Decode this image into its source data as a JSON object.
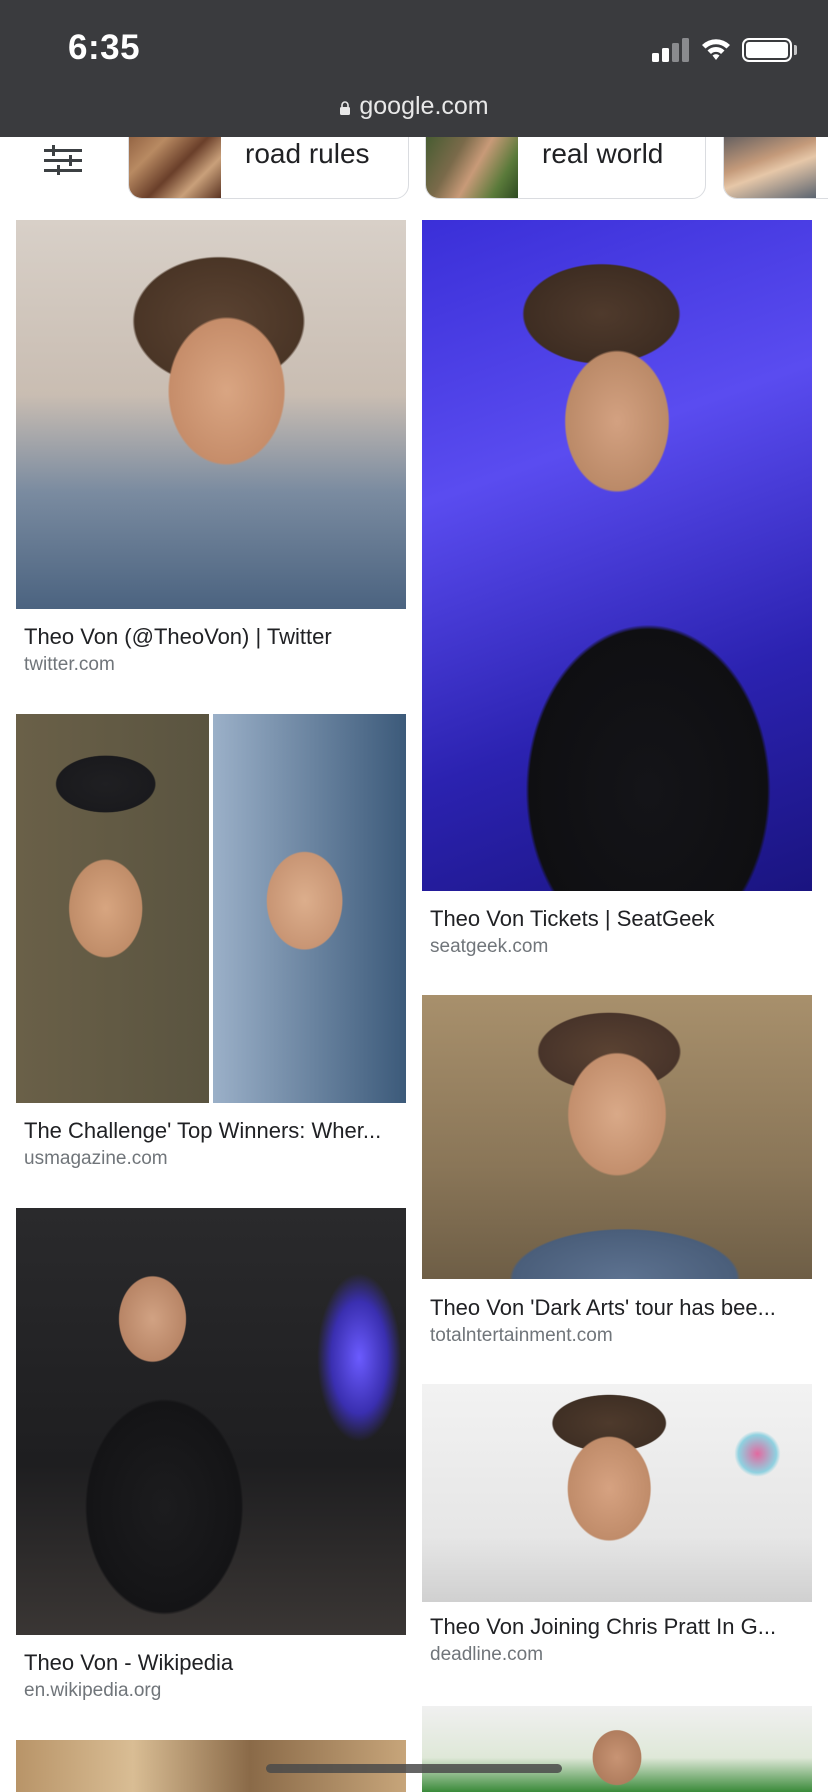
{
  "status_bar": {
    "time": "6:35"
  },
  "browser": {
    "url": "google.com"
  },
  "related_chips": [
    {
      "label": "road rules"
    },
    {
      "label": "real world"
    },
    {
      "label": ""
    }
  ],
  "results": [
    {
      "title": "Theo Von (@TheoVon) | Twitter",
      "domain": "twitter.com"
    },
    {
      "title": "Theo Von Tickets | SeatGeek",
      "domain": "seatgeek.com"
    },
    {
      "title": "The Challenge' Top Winners: Wher...",
      "domain": "usmagazine.com"
    },
    {
      "title": "Theo Von 'Dark Arts' tour has bee...",
      "domain": "totalntertainment.com"
    },
    {
      "title": "Theo Von - Wikipedia",
      "domain": "en.wikipedia.org"
    },
    {
      "title": "Theo Von Joining Chris Pratt In G...",
      "domain": "deadline.com"
    }
  ],
  "colors": {
    "chrome_bg": "#3a3b3e",
    "text": "#202124",
    "domain": "#70757a"
  },
  "icons": [
    "tune-icon",
    "signal-icon",
    "wifi-icon",
    "battery-icon",
    "lock-icon"
  ]
}
